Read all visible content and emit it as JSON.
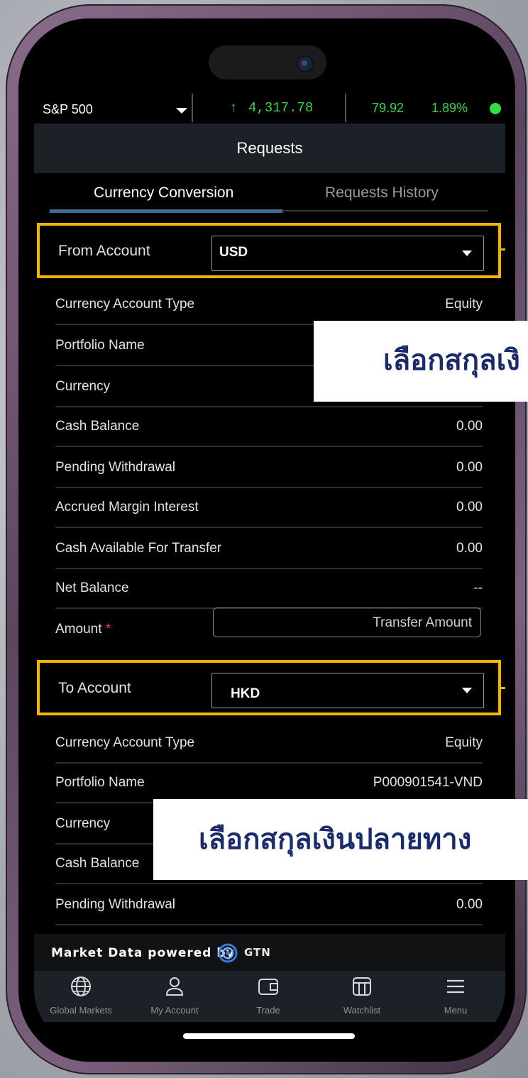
{
  "ticker": {
    "index_name": "S&P 500",
    "price": "4,317.78",
    "change": "79.92",
    "change_pct": "1.89%",
    "status_color": "#2fe03f",
    "up_color": "#3ad04a"
  },
  "header": {
    "title": "Requests"
  },
  "tabs": [
    {
      "label": "Currency Conversion",
      "active": true
    },
    {
      "label": "Requests History",
      "active": false
    }
  ],
  "from_section": {
    "label": "From Account",
    "selected": "USD",
    "rows": [
      {
        "label": "Currency Account Type",
        "value": "Equity"
      },
      {
        "label": "Portfolio Name",
        "value": ""
      },
      {
        "label": "Currency",
        "value": ""
      },
      {
        "label": "Cash Balance",
        "value": "0.00"
      },
      {
        "label": "Pending Withdrawal",
        "value": "0.00"
      },
      {
        "label": "Accrued Margin Interest",
        "value": "0.00"
      },
      {
        "label": "Cash Available For Transfer",
        "value": "0.00"
      },
      {
        "label": "Net Balance",
        "value": "--"
      }
    ],
    "amount_label": "Amount",
    "required_mark": "*",
    "amount_placeholder": "Transfer Amount"
  },
  "to_section": {
    "label": "To Account",
    "selected": "HKD",
    "rows": [
      {
        "label": "Currency Account Type",
        "value": "Equity"
      },
      {
        "label": "Portfolio Name",
        "value": "P000901541-VND"
      },
      {
        "label": "Currency",
        "value": ""
      },
      {
        "label": "Cash Balance",
        "value": ""
      },
      {
        "label": "Pending Withdrawal",
        "value": "0.00"
      }
    ]
  },
  "callouts": {
    "source": "เลือกสกุลเงิ",
    "destination": "เลือกสกุลเงินปลายทาง"
  },
  "footer": {
    "powered_text": "Market Data powered by",
    "brand": "GTN"
  },
  "nav": [
    {
      "label": "Global Markets",
      "icon": "globe-icon"
    },
    {
      "label": "My Account",
      "icon": "user-icon"
    },
    {
      "label": "Trade",
      "icon": "wallet-icon"
    },
    {
      "label": "Watchlist",
      "icon": "watchlist-icon"
    },
    {
      "label": "Menu",
      "icon": "menu-icon"
    }
  ],
  "colors": {
    "highlight": "#f4b400",
    "accent_tab": "#3e6f96",
    "callout_text": "#1b2b6b"
  }
}
